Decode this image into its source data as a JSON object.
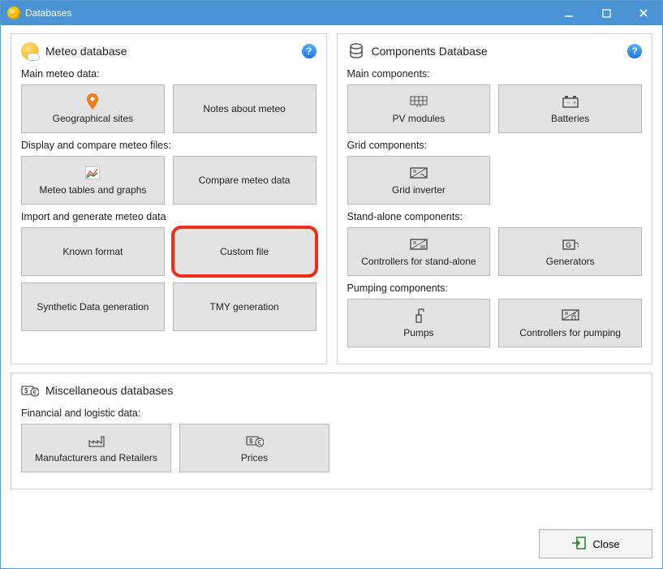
{
  "window": {
    "title": "Databases"
  },
  "meteo": {
    "title": "Meteo database",
    "sec1": "Main meteo data:",
    "geo": "Geographical sites",
    "notes": "Notes about meteo",
    "sec2": "Display and compare meteo files:",
    "tables": "Meteo tables and graphs",
    "compare": "Compare meteo data",
    "sec3": "Import and generate meteo data",
    "known": "Known format",
    "custom": "Custom file",
    "synth": "Synthetic Data generation",
    "tmy": "TMY generation"
  },
  "components": {
    "title": "Components Database",
    "sec1": "Main components:",
    "pv": "PV modules",
    "batt": "Batteries",
    "sec2": "Grid components:",
    "gridinv": "Grid inverter",
    "sec3": "Stand-alone components:",
    "ctrlstand": "Controllers for stand-alone",
    "gen": "Generators",
    "sec4": "Pumping components:",
    "pumps": "Pumps",
    "ctrlpump": "Controllers for pumping"
  },
  "misc": {
    "title": "Miscellaneous databases",
    "sec1": "Financial and logistic data:",
    "manu": "Manufacturers and Retailers",
    "prices": "Prices"
  },
  "footer": {
    "close": "Close"
  },
  "help": "?"
}
